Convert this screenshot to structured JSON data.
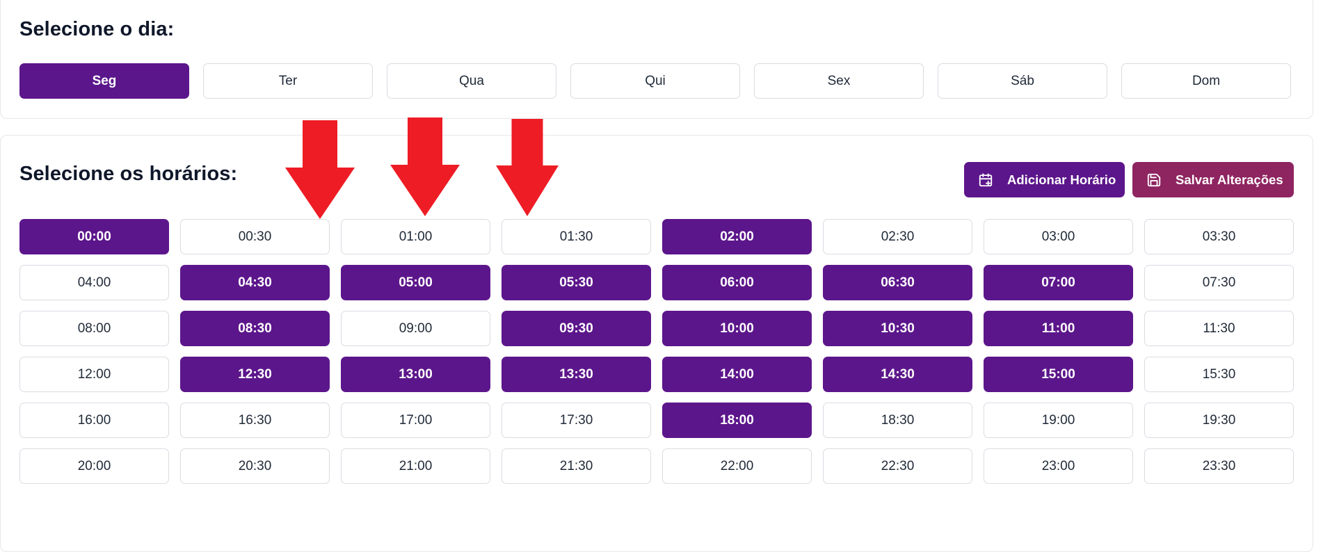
{
  "day_section": {
    "title": "Selecione o dia:",
    "days": [
      {
        "label": "Seg",
        "active": true
      },
      {
        "label": "Ter",
        "active": false
      },
      {
        "label": "Qua",
        "active": false
      },
      {
        "label": "Qui",
        "active": false
      },
      {
        "label": "Sex",
        "active": false
      },
      {
        "label": "Sáb",
        "active": false
      },
      {
        "label": "Dom",
        "active": false
      }
    ]
  },
  "hours_section": {
    "title": "Selecione os horários:",
    "add_label": "Adicionar Horário",
    "add_icon": "calendar-plus-icon",
    "save_label": "Salvar Alterações",
    "save_icon": "save-icon",
    "slots": [
      {
        "time": "00:00",
        "selected": true
      },
      {
        "time": "00:30",
        "selected": false
      },
      {
        "time": "01:00",
        "selected": false
      },
      {
        "time": "01:30",
        "selected": false
      },
      {
        "time": "02:00",
        "selected": true
      },
      {
        "time": "02:30",
        "selected": false
      },
      {
        "time": "03:00",
        "selected": false
      },
      {
        "time": "03:30",
        "selected": false
      },
      {
        "time": "04:00",
        "selected": false
      },
      {
        "time": "04:30",
        "selected": true
      },
      {
        "time": "05:00",
        "selected": true
      },
      {
        "time": "05:30",
        "selected": true
      },
      {
        "time": "06:00",
        "selected": true
      },
      {
        "time": "06:30",
        "selected": true
      },
      {
        "time": "07:00",
        "selected": true
      },
      {
        "time": "07:30",
        "selected": false
      },
      {
        "time": "08:00",
        "selected": false
      },
      {
        "time": "08:30",
        "selected": true
      },
      {
        "time": "09:00",
        "selected": false
      },
      {
        "time": "09:30",
        "selected": true
      },
      {
        "time": "10:00",
        "selected": true
      },
      {
        "time": "10:30",
        "selected": true
      },
      {
        "time": "11:00",
        "selected": true
      },
      {
        "time": "11:30",
        "selected": false
      },
      {
        "time": "12:00",
        "selected": false
      },
      {
        "time": "12:30",
        "selected": true
      },
      {
        "time": "13:00",
        "selected": true
      },
      {
        "time": "13:30",
        "selected": true
      },
      {
        "time": "14:00",
        "selected": true
      },
      {
        "time": "14:30",
        "selected": true
      },
      {
        "time": "15:00",
        "selected": true
      },
      {
        "time": "15:30",
        "selected": false
      },
      {
        "time": "16:00",
        "selected": false
      },
      {
        "time": "16:30",
        "selected": false
      },
      {
        "time": "17:00",
        "selected": false
      },
      {
        "time": "17:30",
        "selected": false
      },
      {
        "time": "18:00",
        "selected": true
      },
      {
        "time": "18:30",
        "selected": false
      },
      {
        "time": "19:00",
        "selected": false
      },
      {
        "time": "19:30",
        "selected": false
      },
      {
        "time": "20:00",
        "selected": false
      },
      {
        "time": "20:30",
        "selected": false
      },
      {
        "time": "21:00",
        "selected": false
      },
      {
        "time": "21:30",
        "selected": false
      },
      {
        "time": "22:00",
        "selected": false
      },
      {
        "time": "22:30",
        "selected": false
      },
      {
        "time": "23:00",
        "selected": false
      },
      {
        "time": "23:30",
        "selected": false
      }
    ]
  },
  "annotations": {
    "arrow_color": "#ee1c25",
    "arrows_point_to": [
      "00:30",
      "01:00",
      "01:30"
    ]
  },
  "colors": {
    "primary": "#5c168b",
    "save": "#8e2460",
    "border": "#d9dce2"
  }
}
